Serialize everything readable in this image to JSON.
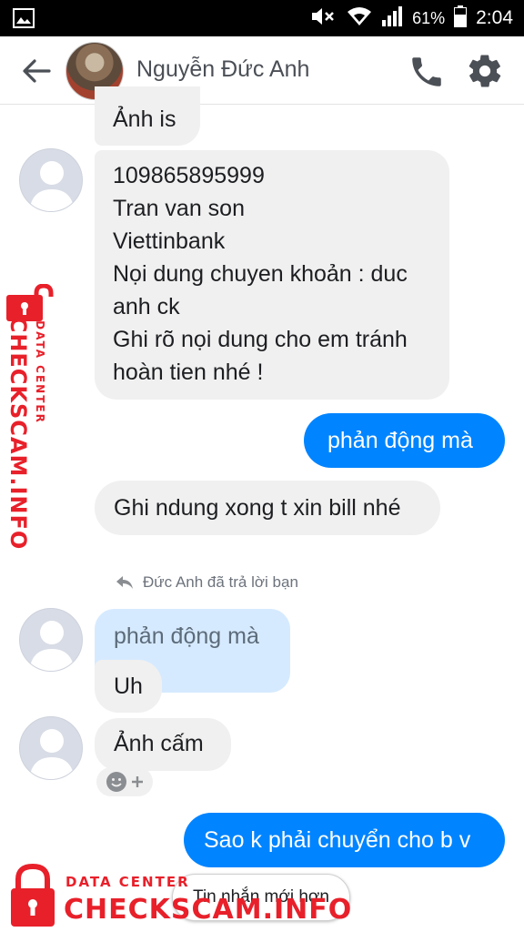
{
  "status_bar": {
    "icons": [
      "image-icon",
      "mute-icon",
      "wifi-icon",
      "signal-icon",
      "battery-icon"
    ],
    "battery": "61%",
    "time": "2:04"
  },
  "header": {
    "contact_name": "Nguyễn Đức Anh",
    "icons": [
      "back-arrow-icon",
      "phone-icon",
      "gear-icon"
    ]
  },
  "messages": {
    "m1": {
      "lines": [
        "Ảnh is"
      ]
    },
    "m2": {
      "lines": [
        "109865895999",
        "Tran van son",
        "Viettinbank",
        "Nọi dung chuyen khoản : duc",
        "anh ck",
        "Ghi rõ nọi dung cho em tránh",
        "hoàn tien nhé !"
      ]
    },
    "m3": {
      "lines": [
        "phản động mà"
      ]
    },
    "m4": {
      "lines": [
        "Ghi ndung xong t xin bill nhé"
      ]
    },
    "reply_note": "Đức Anh đã trả lời bạn",
    "m5_quoted": {
      "lines": [
        "phản động mà"
      ]
    },
    "m5": {
      "lines": [
        "Uh"
      ]
    },
    "m6": {
      "lines": [
        "Ảnh cấm"
      ]
    },
    "m7": {
      "lines": [
        "Sao k phải chuyển cho b v"
      ]
    }
  },
  "newer_messages_button": "Tin nhắn mới hơn",
  "watermark": {
    "small": "DATA CENTER",
    "big": "CHECKSCAM.INFO",
    "color": "#e8202a"
  },
  "colors": {
    "outgoing": "#0084ff",
    "incoming": "#f1f0f0",
    "quoted": "#d6eaff"
  }
}
